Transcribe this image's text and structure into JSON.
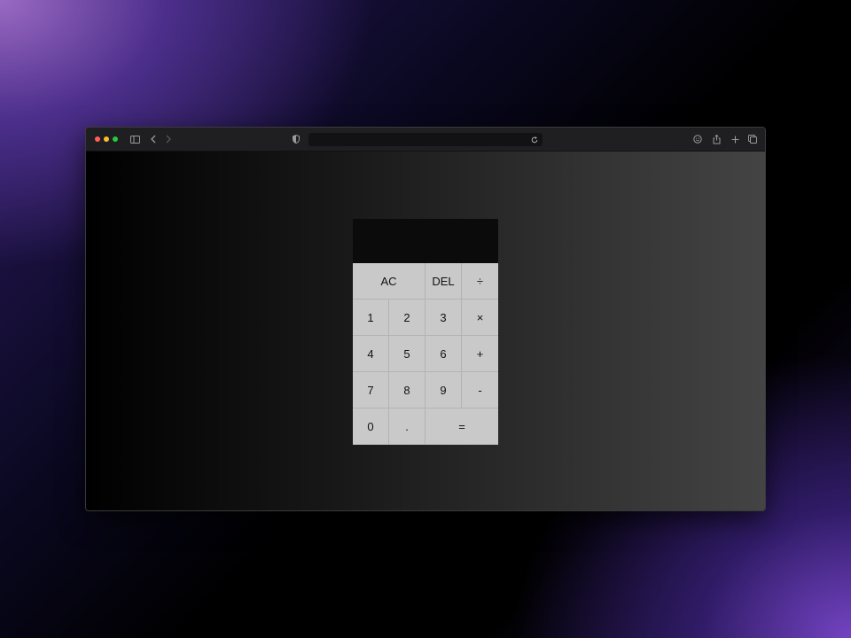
{
  "browser": {
    "address_text": ""
  },
  "calculator": {
    "display_value": "",
    "keys": {
      "ac": "AC",
      "del": "DEL",
      "divide": "÷",
      "one": "1",
      "two": "2",
      "three": "3",
      "multiply": "×",
      "four": "4",
      "five": "5",
      "six": "6",
      "plus": "+",
      "seven": "7",
      "eight": "8",
      "nine": "9",
      "minus": "-",
      "zero": "0",
      "decimal": ".",
      "equals": "="
    }
  },
  "colors": {
    "close": "#ff5f57",
    "minimize": "#febc2e",
    "maximize": "#28c840",
    "display_bg": "#0b0b0b",
    "key_bg": "#c9c9c9"
  },
  "icons": [
    "sidebar-icon",
    "chevron-left-icon",
    "chevron-right-icon",
    "shield-icon",
    "reload-icon",
    "extension-icon",
    "share-icon",
    "plus-icon",
    "tabs-icon"
  ]
}
